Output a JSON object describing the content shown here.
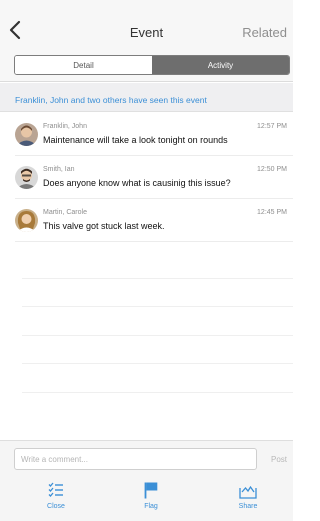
{
  "header": {
    "back_icon": "chevron-left-icon",
    "title": "Event",
    "related_label": "Related"
  },
  "tabs": {
    "detail_label": "Detail",
    "activity_label": "Activity",
    "selected": "Activity"
  },
  "seen_banner": "Franklin, John and two others have seen this event",
  "comments": [
    {
      "author": "Franklin, John",
      "time": "12:57 PM",
      "text": "Maintenance will take a look tonight on rounds"
    },
    {
      "author": "Smith, Ian",
      "time": "12:50 PM",
      "text": "Does anyone know what is causinig this issue?"
    },
    {
      "author": "Martin, Carole",
      "time": "12:45 PM",
      "text": "This valve got stuck last week."
    }
  ],
  "composer": {
    "placeholder": "Write a comment...",
    "value": "",
    "post_label": "Post"
  },
  "toolbar": {
    "close_label": "Close",
    "flag_label": "Flag",
    "share_label": "Share",
    "icons": [
      "checklist-icon",
      "flag-icon",
      "share-icon"
    ]
  },
  "colors": {
    "accent": "#3b8fd6",
    "segment_selected": "#6e6e6e",
    "banner_bg": "#efeff1"
  }
}
